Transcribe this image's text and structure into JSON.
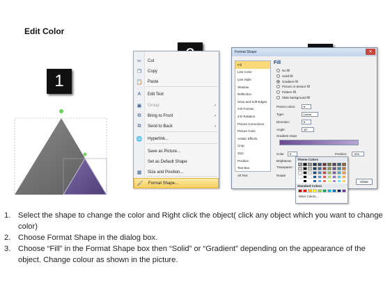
{
  "title": "Edit Color",
  "badges": [
    "1",
    "2",
    "3"
  ],
  "context_menu": {
    "items": [
      {
        "icon": "scissors-icon",
        "glyph": "✂",
        "label": "Cut",
        "disabled": false,
        "submenu": false
      },
      {
        "icon": "copy-icon",
        "glyph": "❐",
        "label": "Copy",
        "disabled": false,
        "submenu": false
      },
      {
        "icon": "paste-icon",
        "glyph": "📋",
        "label": "Paste",
        "disabled": false,
        "submenu": false
      },
      {
        "icon": "edit-text-icon",
        "glyph": "A",
        "label": "Edit Text",
        "disabled": false,
        "submenu": false
      },
      {
        "icon": "group-icon",
        "glyph": "▣",
        "label": "Group",
        "disabled": true,
        "submenu": true
      },
      {
        "icon": "bring-front-icon",
        "glyph": "⧉",
        "label": "Bring to Front",
        "disabled": false,
        "submenu": true
      },
      {
        "icon": "send-back-icon",
        "glyph": "⧉",
        "label": "Send to Back",
        "disabled": false,
        "submenu": true
      },
      {
        "icon": "hyperlink-icon",
        "glyph": "🌐",
        "label": "Hyperlink...",
        "disabled": false,
        "submenu": false
      },
      {
        "icon": "",
        "glyph": "",
        "label": "Save as Picture...",
        "disabled": false,
        "submenu": false
      },
      {
        "icon": "",
        "glyph": "",
        "label": "Set as Default Shape",
        "disabled": false,
        "submenu": false
      },
      {
        "icon": "size-position-icon",
        "glyph": "▦",
        "label": "Size and Position...",
        "disabled": false,
        "submenu": false
      },
      {
        "icon": "format-shape-icon",
        "glyph": "🖌",
        "label": "Format Shape...",
        "disabled": false,
        "submenu": false,
        "highlight": true
      }
    ]
  },
  "dialog": {
    "title": "Format Shape",
    "categories": [
      "Fill",
      "Line Color",
      "Line Style",
      "Shadow",
      "Reflection",
      "Glow and Soft Edges",
      "3-D Format",
      "3-D Rotation",
      "Picture Corrections",
      "Picture Color",
      "Artistic Effects",
      "Crop",
      "Size",
      "Position",
      "Text Box",
      "Alt Text"
    ],
    "active_category": "Fill",
    "section_heading": "Fill",
    "fill_options": [
      "No fill",
      "Solid fill",
      "Gradient fill",
      "Picture or texture fill",
      "Pattern fill",
      "Slide background fill"
    ],
    "selected_fill": "Gradient fill",
    "preset_colors_label": "Preset colors:",
    "type_label": "Type:",
    "type_value": "Linear",
    "direction_label": "Direction:",
    "angle_label": "Angle:",
    "angle_value": "45°",
    "gradient_stops_label": "Gradient stops",
    "color_label": "Color",
    "position_label": "Position:",
    "position_value": "15%",
    "brightness_label": "Brightness",
    "transparency_label": "Transparen",
    "rotate_label": "Rotate",
    "close_button": "Close"
  },
  "palette": {
    "theme_heading": "Theme Colors",
    "standard_heading": "Standard Colors",
    "more_colors": "More Colors...",
    "theme_colors": [
      "#ffffff",
      "#000000",
      "#eeece1",
      "#1f497d",
      "#4f81bd",
      "#c0504d",
      "#9bbb59",
      "#8064a2",
      "#4bacc6",
      "#f79646"
    ],
    "standard_colors": [
      "#c00000",
      "#ff0000",
      "#ffc000",
      "#ffff00",
      "#92d050",
      "#00b050",
      "#00b0f0",
      "#0070c0",
      "#002060",
      "#7030a0"
    ]
  },
  "instructions": [
    {
      "num": "1.",
      "text": "Select the shape to change the color and Right click the object( click any object which you want to change color)"
    },
    {
      "num": "2.",
      "text": "Choose Format Shape in the dialog box."
    },
    {
      "num": "3.",
      "text": "Choose “Fill” in the Format Shape box then “Solid” or “Gradient” depending on the appearance of the object. Change colour as shown in the picture."
    }
  ]
}
